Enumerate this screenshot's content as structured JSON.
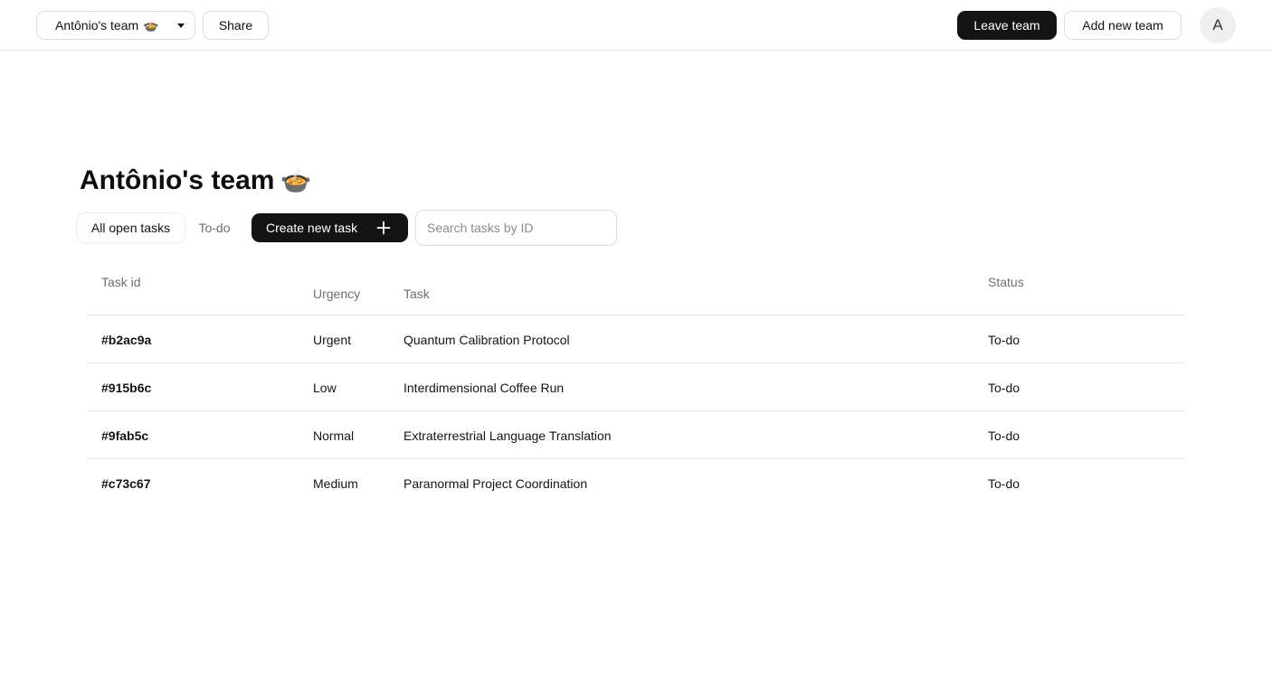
{
  "header": {
    "team_select": {
      "label": "Antônio's team",
      "emoji": "🍲"
    },
    "share_label": "Share",
    "leave_label": "Leave team",
    "add_team_label": "Add new team",
    "avatar_initial": "A"
  },
  "page": {
    "title": "Antônio's team",
    "title_emoji": "🍲"
  },
  "toolbar": {
    "tabs": [
      {
        "label": "All open tasks",
        "active": true
      },
      {
        "label": "To-do",
        "active": false
      }
    ],
    "create_label": "Create new task",
    "search": {
      "placeholder": "Search tasks by ID",
      "value": ""
    }
  },
  "table": {
    "columns": {
      "id": "Task id",
      "urgency": "Urgency",
      "task": "Task",
      "status": "Status"
    },
    "rows": [
      {
        "id": "#b2ac9a",
        "urgency": "Urgent",
        "task": "Quantum Calibration Protocol",
        "status": "To-do"
      },
      {
        "id": "#915b6c",
        "urgency": "Low",
        "task": "Interdimensional Coffee Run",
        "status": "To-do"
      },
      {
        "id": "#9fab5c",
        "urgency": "Normal",
        "task": "Extraterrestrial Language Translation",
        "status": "To-do"
      },
      {
        "id": "#c73c67",
        "urgency": "Medium",
        "task": "Paranormal Project Coordination",
        "status": "To-do"
      }
    ]
  },
  "icons": {
    "team_caret": "chevron-down-icon",
    "create_plus": "plus-icon"
  },
  "colors": {
    "primary_button": "#141414",
    "border": "#dcdcdc",
    "muted_text": "#6e6e6e"
  }
}
